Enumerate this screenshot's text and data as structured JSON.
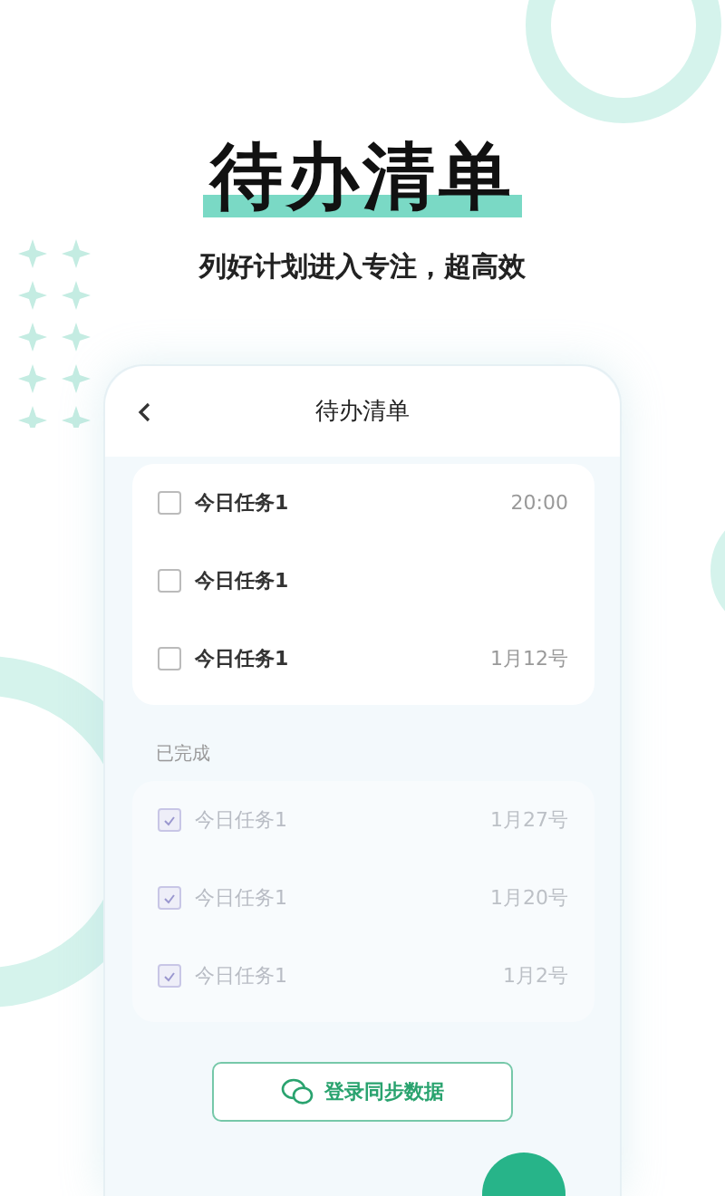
{
  "headline": "待办清单",
  "subtitle": "列好计划进入专注，超高效",
  "app": {
    "header": {
      "title": "待办清单"
    },
    "pending_tasks": [
      {
        "label": "今日任务1",
        "due": "20:00",
        "checked": false
      },
      {
        "label": "今日任务1",
        "checked": false
      },
      {
        "label": "今日任务1",
        "due": "1月12号",
        "checked": false
      }
    ],
    "completed": {
      "heading": "已完成",
      "tasks": [
        {
          "label": "今日任务1",
          "due": "1月27号",
          "checked": true
        },
        {
          "label": "今日任务1",
          "due": "1月20号",
          "checked": true
        },
        {
          "label": "今日任务1",
          "due": "1月2号",
          "checked": true
        }
      ]
    },
    "sync_button": {
      "label": "登录同步数据"
    }
  }
}
